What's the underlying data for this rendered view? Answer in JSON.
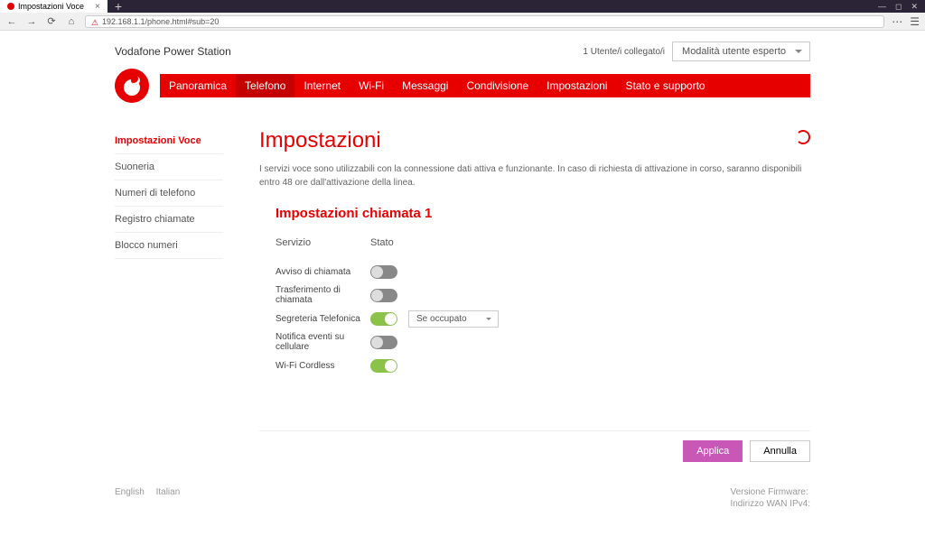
{
  "browser": {
    "tab_title": "Impostazioni Voce",
    "url": "192.168.1.1/phone.html#sub=20"
  },
  "header": {
    "brand": "Vodafone Power Station",
    "users_text": "1 Utente/i collegato/i",
    "mode": "Modalità utente esperto"
  },
  "nav": {
    "items": [
      "Panoramica",
      "Telefono",
      "Internet",
      "Wi-Fi",
      "Messaggi",
      "Condivisione",
      "Impostazioni",
      "Stato e supporto"
    ]
  },
  "sidebar": {
    "items": [
      "Impostazioni Voce",
      "Suoneria",
      "Numeri di telefono",
      "Registro chiamate",
      "Blocco numeri"
    ]
  },
  "main": {
    "title": "Impostazioni",
    "description": "I servizi voce sono utilizzabili con la connessione dati attiva e funzionante. In caso di richiesta di attivazione in corso, saranno disponibili entro 48 ore dall'attivazione della linea.",
    "section_title": "Impostazioni chiamata 1",
    "col_service": "Servizio",
    "col_state": "Stato",
    "rows": [
      {
        "label": "Avviso di chiamata",
        "on": false
      },
      {
        "label": "Trasferimento di chiamata",
        "on": false
      },
      {
        "label": "Segreteria Telefonica",
        "on": true,
        "dropdown": "Se occupato"
      },
      {
        "label": "Notifica eventi su cellulare",
        "on": false
      },
      {
        "label": "Wi-Fi Cordless",
        "on": true
      }
    ],
    "apply": "Applica",
    "cancel": "Annulla"
  },
  "footer": {
    "lang_en": "English",
    "lang_it": "Italian",
    "fw": "Versione Firmware:",
    "ipv4": "Indirizzo WAN IPv4:"
  }
}
